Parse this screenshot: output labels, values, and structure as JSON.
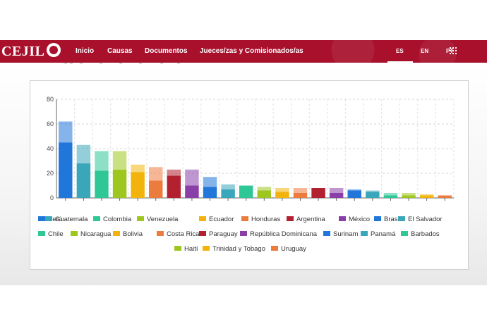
{
  "header": {
    "logo_text": "CEJIL",
    "nav": [
      "Inicio",
      "Causas",
      "Documentos",
      "Jueces/zas y Comisionados/as"
    ],
    "languages": [
      "ES",
      "EN",
      "PT"
    ],
    "active_language": "ES",
    "brand_color": "#a8102c"
  },
  "chart_data": {
    "type": "bar",
    "stacked": true,
    "y_ticks": [
      "0",
      "20",
      "40",
      "60",
      "80"
    ],
    "ylim": [
      0,
      80
    ],
    "grid": true,
    "legend_position": "bottom",
    "categories": [
      "Perú",
      "Guatemala",
      "Colombia",
      "Venezuela",
      "Ecuador",
      "Honduras",
      "Argentina",
      "México",
      "Brasil",
      "El Salvador",
      "Chile",
      "Nicaragua",
      "Bolivia",
      "Costa Rica",
      "Paraguay",
      "República Dominicana",
      "Surinam",
      "Panamá",
      "Barbados",
      "Haití",
      "Trinidad y Tobago",
      "Uruguay"
    ],
    "colors": [
      "#2176d9",
      "#3aa6b9",
      "#2ec795",
      "#9dc61f",
      "#f2b40c",
      "#ec7b3e",
      "#b3202f",
      "#8a3fa8",
      "#2176d9",
      "#3aa6b9",
      "#2ec795",
      "#9dc61f",
      "#f2b40c",
      "#ec7b3e",
      "#b3202f",
      "#8a3fa8",
      "#2176d9",
      "#3aa6b9",
      "#2ec795",
      "#9dc61f",
      "#f2b40c",
      "#ec7b3e"
    ],
    "series": [
      {
        "values": [
          45,
          28,
          22,
          23,
          21,
          14,
          18,
          10,
          9,
          7,
          10,
          6,
          5,
          4,
          8,
          4,
          6,
          5,
          2,
          2,
          2,
          2
        ]
      },
      {
        "values": [
          17,
          15,
          16,
          15,
          6,
          11,
          5,
          13,
          8,
          4,
          0,
          3,
          3,
          4,
          0,
          4,
          1,
          1,
          2,
          2,
          1,
          0
        ]
      }
    ]
  }
}
